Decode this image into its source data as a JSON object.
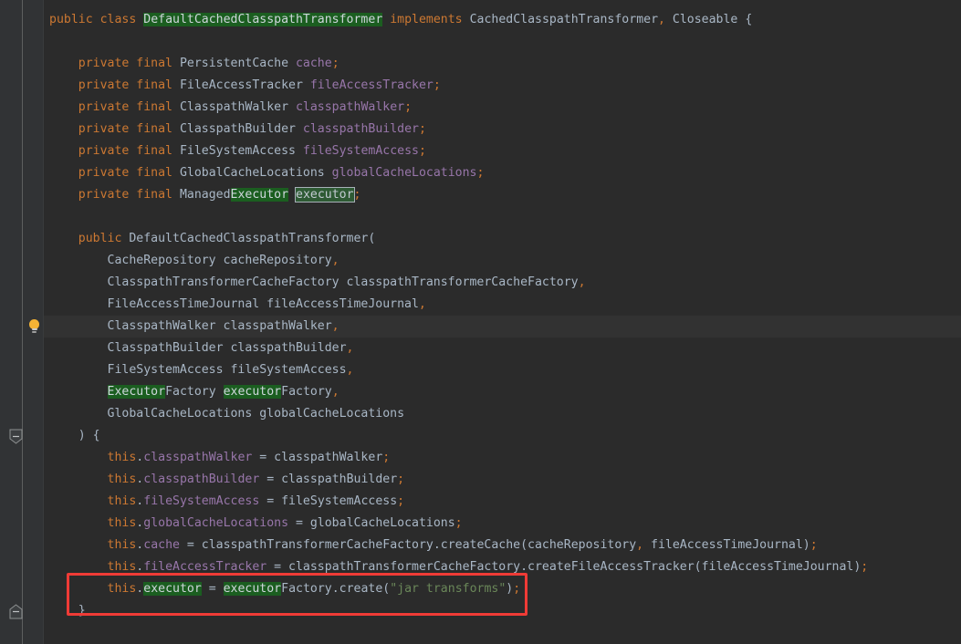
{
  "editor": {
    "theme": "darcula",
    "background": "#2B2B2B",
    "gutter_background": "#313335",
    "current_line_background": "#323232",
    "colors": {
      "keyword": "#CC7832",
      "identifier": "#A9B7C6",
      "field": "#9876AA",
      "string": "#6A8759",
      "highlight_background": "#1B5E20",
      "highlight_current_background": "#2E5A34",
      "annotation_box": "#F03B36"
    },
    "gutter": {
      "intention_bulb": {
        "icon": "lightbulb-icon",
        "line_index": 14,
        "tooltip": "Show context actions"
      },
      "fold_markers": [
        {
          "icon": "fold-collapse-icon",
          "line_index": 19,
          "direction": "down"
        },
        {
          "icon": "fold-end-icon",
          "line_index": 27,
          "direction": "up"
        }
      ]
    },
    "annotation": {
      "shape": "rectangle",
      "color": "#F03B36",
      "target_line_index": 26,
      "target_text": "this.executor = executorFactory.create(\"jar transforms\");"
    },
    "language": "java",
    "lines": [
      {
        "index": 0,
        "tokens": [
          {
            "t": "public",
            "c": "kw"
          },
          {
            "t": " ",
            "c": "plain"
          },
          {
            "t": "class",
            "c": "kw"
          },
          {
            "t": " ",
            "c": "plain"
          },
          {
            "t": "DefaultCachedClasspathTransformer",
            "c": "hl"
          },
          {
            "t": " ",
            "c": "plain"
          },
          {
            "t": "implements",
            "c": "kw"
          },
          {
            "t": " ",
            "c": "plain"
          },
          {
            "t": "CachedClasspathTransformer",
            "c": "plain"
          },
          {
            "t": ",",
            "c": "punct"
          },
          {
            "t": " Closeable ",
            "c": "plain"
          },
          {
            "t": "{",
            "c": "brace"
          }
        ]
      },
      {
        "index": 1,
        "tokens": []
      },
      {
        "index": 2,
        "tokens": [
          {
            "t": "    ",
            "c": "plain"
          },
          {
            "t": "private",
            "c": "kw"
          },
          {
            "t": " ",
            "c": "plain"
          },
          {
            "t": "final",
            "c": "kw"
          },
          {
            "t": " PersistentCache ",
            "c": "plain"
          },
          {
            "t": "cache",
            "c": "field"
          },
          {
            "t": ";",
            "c": "punct"
          }
        ]
      },
      {
        "index": 3,
        "tokens": [
          {
            "t": "    ",
            "c": "plain"
          },
          {
            "t": "private",
            "c": "kw"
          },
          {
            "t": " ",
            "c": "plain"
          },
          {
            "t": "final",
            "c": "kw"
          },
          {
            "t": " FileAccessTracker ",
            "c": "plain"
          },
          {
            "t": "fileAccessTracker",
            "c": "field"
          },
          {
            "t": ";",
            "c": "punct"
          }
        ]
      },
      {
        "index": 4,
        "tokens": [
          {
            "t": "    ",
            "c": "plain"
          },
          {
            "t": "private",
            "c": "kw"
          },
          {
            "t": " ",
            "c": "plain"
          },
          {
            "t": "final",
            "c": "kw"
          },
          {
            "t": " ClasspathWalker ",
            "c": "plain"
          },
          {
            "t": "classpathWalker",
            "c": "field"
          },
          {
            "t": ";",
            "c": "punct"
          }
        ]
      },
      {
        "index": 5,
        "tokens": [
          {
            "t": "    ",
            "c": "plain"
          },
          {
            "t": "private",
            "c": "kw"
          },
          {
            "t": " ",
            "c": "plain"
          },
          {
            "t": "final",
            "c": "kw"
          },
          {
            "t": " ClasspathBuilder ",
            "c": "plain"
          },
          {
            "t": "classpathBuilder",
            "c": "field"
          },
          {
            "t": ";",
            "c": "punct"
          }
        ]
      },
      {
        "index": 6,
        "tokens": [
          {
            "t": "    ",
            "c": "plain"
          },
          {
            "t": "private",
            "c": "kw"
          },
          {
            "t": " ",
            "c": "plain"
          },
          {
            "t": "final",
            "c": "kw"
          },
          {
            "t": " FileSystemAccess ",
            "c": "plain"
          },
          {
            "t": "fileSystemAccess",
            "c": "field"
          },
          {
            "t": ";",
            "c": "punct"
          }
        ]
      },
      {
        "index": 7,
        "tokens": [
          {
            "t": "    ",
            "c": "plain"
          },
          {
            "t": "private",
            "c": "kw"
          },
          {
            "t": " ",
            "c": "plain"
          },
          {
            "t": "final",
            "c": "kw"
          },
          {
            "t": " GlobalCacheLocations ",
            "c": "plain"
          },
          {
            "t": "globalCacheLocations",
            "c": "field"
          },
          {
            "t": ";",
            "c": "punct"
          }
        ]
      },
      {
        "index": 8,
        "tokens": [
          {
            "t": "    ",
            "c": "plain"
          },
          {
            "t": "private",
            "c": "kw"
          },
          {
            "t": " ",
            "c": "plain"
          },
          {
            "t": "final",
            "c": "kw"
          },
          {
            "t": " Managed",
            "c": "plain"
          },
          {
            "t": "Executor",
            "c": "hl"
          },
          {
            "t": " ",
            "c": "plain"
          },
          {
            "t": "executor",
            "c": "hl-cur"
          },
          {
            "t": ";",
            "c": "punct"
          }
        ]
      },
      {
        "index": 9,
        "tokens": []
      },
      {
        "index": 10,
        "tokens": [
          {
            "t": "    ",
            "c": "plain"
          },
          {
            "t": "public",
            "c": "kw"
          },
          {
            "t": " DefaultCachedClasspathTransformer",
            "c": "plain"
          },
          {
            "t": "(",
            "c": "plain"
          }
        ]
      },
      {
        "index": 11,
        "tokens": [
          {
            "t": "        CacheRepository cacheRepository",
            "c": "plain"
          },
          {
            "t": ",",
            "c": "punct"
          }
        ]
      },
      {
        "index": 12,
        "tokens": [
          {
            "t": "        ClasspathTransformerCacheFactory classpathTransformerCacheFactory",
            "c": "plain"
          },
          {
            "t": ",",
            "c": "punct"
          }
        ]
      },
      {
        "index": 13,
        "tokens": [
          {
            "t": "        FileAccessTimeJournal fileAccessTimeJournal",
            "c": "plain"
          },
          {
            "t": ",",
            "c": "punct"
          }
        ]
      },
      {
        "index": 14,
        "current": true,
        "tokens": [
          {
            "t": "        ClasspathWalker classpathWalker",
            "c": "plain"
          },
          {
            "t": ",",
            "c": "punct"
          }
        ]
      },
      {
        "index": 15,
        "tokens": [
          {
            "t": "        ClasspathBuilder classpathBuilder",
            "c": "plain"
          },
          {
            "t": ",",
            "c": "punct"
          }
        ]
      },
      {
        "index": 16,
        "tokens": [
          {
            "t": "        FileSystemAccess fileSystemAccess",
            "c": "plain"
          },
          {
            "t": ",",
            "c": "punct"
          }
        ]
      },
      {
        "index": 17,
        "tokens": [
          {
            "t": "        ",
            "c": "plain"
          },
          {
            "t": "Executor",
            "c": "hl"
          },
          {
            "t": "Factory ",
            "c": "plain"
          },
          {
            "t": "executor",
            "c": "hl"
          },
          {
            "t": "Factory",
            "c": "plain"
          },
          {
            "t": ",",
            "c": "punct"
          }
        ]
      },
      {
        "index": 18,
        "tokens": [
          {
            "t": "        GlobalCacheLocations globalCacheLocations",
            "c": "plain"
          }
        ]
      },
      {
        "index": 19,
        "tokens": [
          {
            "t": "    ",
            "c": "plain"
          },
          {
            "t": ")",
            "c": "plain"
          },
          {
            "t": " ",
            "c": "plain"
          },
          {
            "t": "{",
            "c": "brace"
          }
        ]
      },
      {
        "index": 20,
        "tokens": [
          {
            "t": "        ",
            "c": "plain"
          },
          {
            "t": "this",
            "c": "kw"
          },
          {
            "t": ".",
            "c": "plain"
          },
          {
            "t": "classpathWalker",
            "c": "field"
          },
          {
            "t": " = classpathWalker",
            "c": "plain"
          },
          {
            "t": ";",
            "c": "punct"
          }
        ]
      },
      {
        "index": 21,
        "tokens": [
          {
            "t": "        ",
            "c": "plain"
          },
          {
            "t": "this",
            "c": "kw"
          },
          {
            "t": ".",
            "c": "plain"
          },
          {
            "t": "classpathBuilder",
            "c": "field"
          },
          {
            "t": " = classpathBuilder",
            "c": "plain"
          },
          {
            "t": ";",
            "c": "punct"
          }
        ]
      },
      {
        "index": 22,
        "tokens": [
          {
            "t": "        ",
            "c": "plain"
          },
          {
            "t": "this",
            "c": "kw"
          },
          {
            "t": ".",
            "c": "plain"
          },
          {
            "t": "fileSystemAccess",
            "c": "field"
          },
          {
            "t": " = fileSystemAccess",
            "c": "plain"
          },
          {
            "t": ";",
            "c": "punct"
          }
        ]
      },
      {
        "index": 23,
        "tokens": [
          {
            "t": "        ",
            "c": "plain"
          },
          {
            "t": "this",
            "c": "kw"
          },
          {
            "t": ".",
            "c": "plain"
          },
          {
            "t": "globalCacheLocations",
            "c": "field"
          },
          {
            "t": " = globalCacheLocations",
            "c": "plain"
          },
          {
            "t": ";",
            "c": "punct"
          }
        ]
      },
      {
        "index": 24,
        "tokens": [
          {
            "t": "        ",
            "c": "plain"
          },
          {
            "t": "this",
            "c": "kw"
          },
          {
            "t": ".",
            "c": "plain"
          },
          {
            "t": "cache",
            "c": "field"
          },
          {
            "t": " = classpathTransformerCacheFactory.createCache(cacheRepository",
            "c": "plain"
          },
          {
            "t": ",",
            "c": "punct"
          },
          {
            "t": " fileAccessTimeJournal)",
            "c": "plain"
          },
          {
            "t": ";",
            "c": "punct"
          }
        ]
      },
      {
        "index": 25,
        "tokens": [
          {
            "t": "        ",
            "c": "plain"
          },
          {
            "t": "this",
            "c": "kw"
          },
          {
            "t": ".",
            "c": "plain"
          },
          {
            "t": "fileAccessTracker",
            "c": "field"
          },
          {
            "t": " = classpathTransformerCacheFactory.createFileAccessTracker(fileAccessTimeJournal)",
            "c": "plain"
          },
          {
            "t": ";",
            "c": "punct"
          }
        ]
      },
      {
        "index": 26,
        "tokens": [
          {
            "t": "        ",
            "c": "plain"
          },
          {
            "t": "this",
            "c": "kw"
          },
          {
            "t": ".",
            "c": "plain"
          },
          {
            "t": "executor",
            "c": "hl"
          },
          {
            "t": " = ",
            "c": "plain"
          },
          {
            "t": "executor",
            "c": "hl"
          },
          {
            "t": "Factory.create(",
            "c": "plain"
          },
          {
            "t": "\"jar transforms\"",
            "c": "str"
          },
          {
            "t": ")",
            "c": "plain"
          },
          {
            "t": ";",
            "c": "punct"
          }
        ]
      },
      {
        "index": 27,
        "tokens": [
          {
            "t": "    ",
            "c": "plain"
          },
          {
            "t": "}",
            "c": "brace"
          }
        ]
      }
    ]
  }
}
